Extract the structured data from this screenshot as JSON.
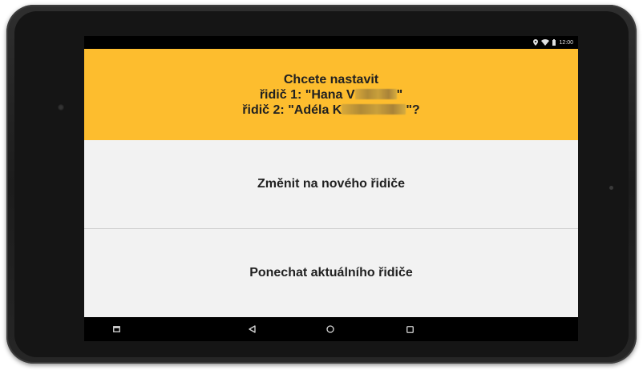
{
  "status_bar": {
    "time": "12:00",
    "icons": [
      "location-icon",
      "wifi-icon",
      "battery-icon"
    ]
  },
  "dialog": {
    "title": "Chcete nastavit",
    "driver1_prefix": "řidič 1: \"Hana V",
    "driver1_suffix": "\"",
    "driver2_prefix": "řidič 2: \"Adéla K",
    "driver2_suffix": "\"?"
  },
  "options": {
    "change_label": "Změnit na nového řidiče",
    "keep_label": "Ponechat aktuálního řidiče"
  },
  "nav_bar": {
    "icons": [
      "menu-icon",
      "back-icon",
      "home-icon",
      "recents-icon"
    ]
  },
  "colors": {
    "header": "#fdbd2e",
    "background": "#f2f2f2",
    "bars": "#000000"
  }
}
